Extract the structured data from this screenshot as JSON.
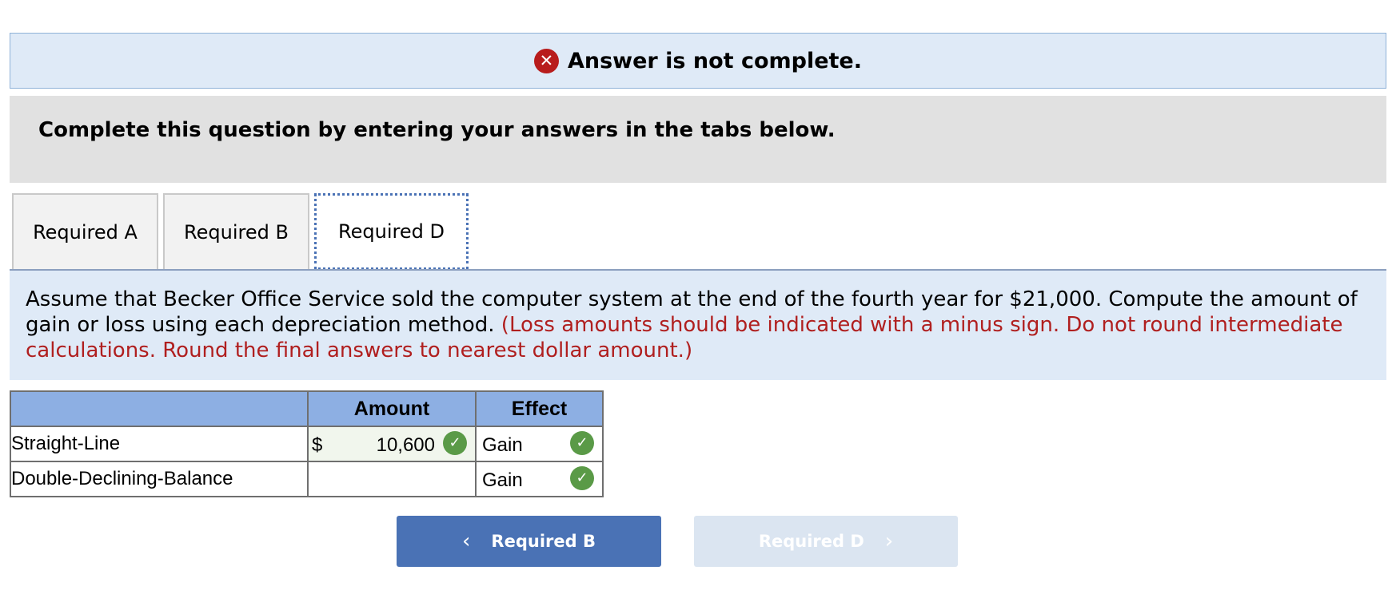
{
  "status": {
    "icon": "error-x-icon",
    "text": "Answer is not complete.",
    "color": "#b81c1c"
  },
  "instruction": "Complete this question by entering your answers in the tabs below.",
  "tabs": [
    {
      "label": "Required A",
      "active": false
    },
    {
      "label": "Required B",
      "active": false
    },
    {
      "label": "Required D",
      "active": true
    }
  ],
  "question": {
    "text": "Assume that Becker Office Service sold the computer system at the end of the fourth year for $21,000. Compute the amount of gain or loss using each depreciation method.",
    "hint": "(Loss amounts should be indicated with a minus sign. Do not round intermediate calculations. Round the final answers to nearest dollar amount.)"
  },
  "table": {
    "headers": [
      "",
      "Amount",
      "Effect"
    ],
    "rows": [
      {
        "label": "Straight-Line",
        "currency": "$",
        "amount": "10,600",
        "amount_correct": true,
        "effect": "Gain",
        "effect_correct": true
      },
      {
        "label": "Double-Declining-Balance",
        "currency": "",
        "amount": "",
        "amount_correct": false,
        "effect": "Gain",
        "effect_correct": true
      }
    ]
  },
  "nav": {
    "prev_label": "Required B",
    "prev_icon": "chevron-left-icon",
    "next_label": "Required D",
    "next_icon": "chevron-right-icon"
  },
  "colors": {
    "accent": "#4a72b5",
    "correct": "#5a9a47",
    "hint": "#b01f1f"
  }
}
